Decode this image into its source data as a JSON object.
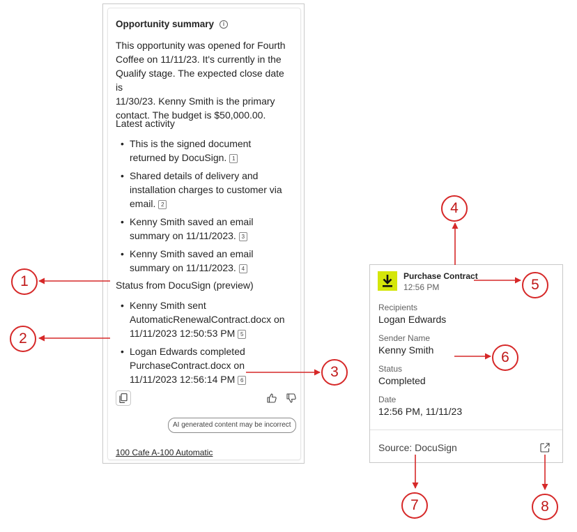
{
  "summary_panel": {
    "title": "Opportunity summary",
    "info_icon": "info-icon",
    "summary_lines": [
      "This opportunity was opened for Fourth",
      "Coffee on 11/11/23. It's currently in the",
      "Qualify stage. The expected close date is",
      "11/30/23. Kenny Smith is the primary",
      "contact. The budget is $50,000.00."
    ],
    "latest_activity_label": "Latest activity",
    "latest_activity": [
      {
        "lines": [
          "This is the signed document",
          "returned by DocuSign."
        ],
        "cite": "1"
      },
      {
        "lines": [
          "Shared details of delivery and",
          "installation charges to customer via",
          "email."
        ],
        "cite": "2"
      },
      {
        "lines": [
          "Kenny Smith saved an email",
          "summary on 11/11/2023."
        ],
        "cite": "3"
      },
      {
        "lines": [
          "Kenny Smith saved an email",
          "summary on 11/11/2023."
        ],
        "cite": "4"
      }
    ],
    "docusign_label": "Status from DocuSign (preview)",
    "docusign_items": [
      {
        "lines": [
          "Kenny Smith sent",
          "AutomaticRenewalContract.docx on",
          "11/11/2023 12:50:53 PM"
        ],
        "cite": "5"
      },
      {
        "lines": [
          "Logan Edwards completed",
          "PurchaseContract.docx on",
          "11/11/2023 12:56:14 PM"
        ],
        "cite": "6"
      }
    ],
    "copy_icon": "copy-icon",
    "thumbs_up_icon": "thumbs-up-icon",
    "thumbs_down_icon": "thumbs-down-icon",
    "ai_badge": "AI generated content may be incorrect",
    "footer_link": "100 Cafe A-100 Automatic"
  },
  "contract_card": {
    "icon": "download-icon",
    "icon_color": "#d4e60a",
    "title": "Purchase Contract",
    "time": "12:56 PM",
    "fields": [
      {
        "label": "Recipients",
        "value": "Logan Edwards"
      },
      {
        "label": "Sender Name",
        "value": "Kenny Smith"
      },
      {
        "label": "Status",
        "value": "Completed"
      },
      {
        "label": "Date",
        "value": "12:56 PM, 11/11/23"
      }
    ],
    "source": "Source: DocuSign",
    "external_link_icon": "external-link-icon"
  },
  "callouts": [
    "1",
    "2",
    "3",
    "4",
    "5",
    "6",
    "7",
    "8"
  ],
  "callout_color": "#d62828"
}
